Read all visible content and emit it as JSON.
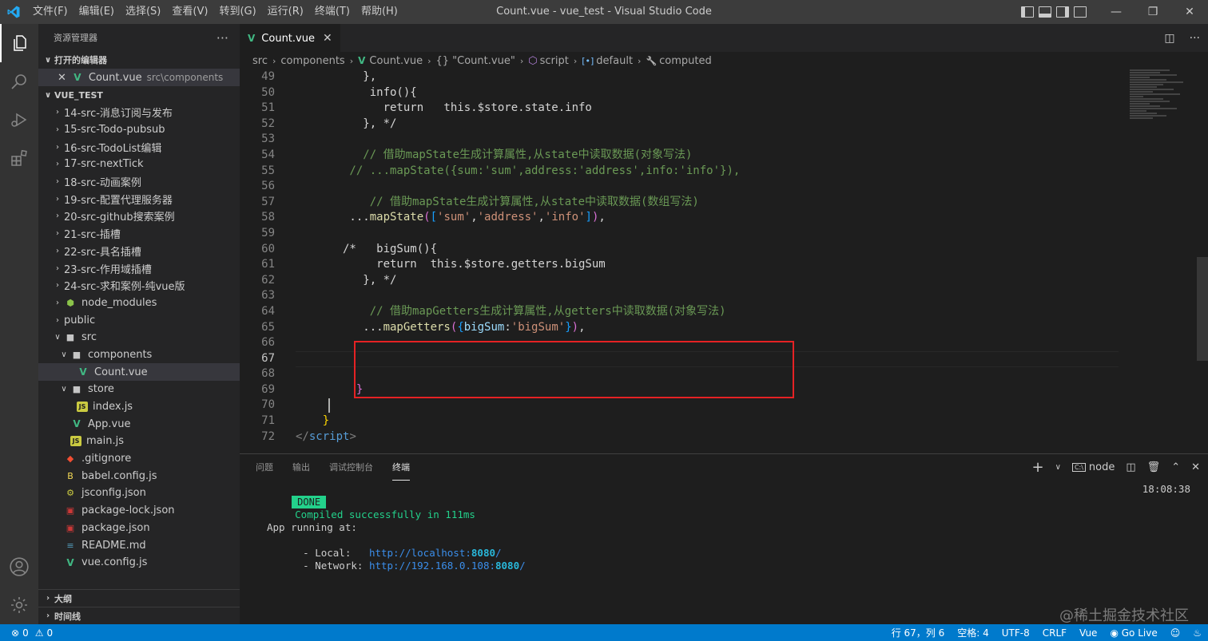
{
  "titlebar": {
    "title": "Count.vue - vue_test - Visual Studio Code",
    "menu": [
      "文件(F)",
      "编辑(E)",
      "选择(S)",
      "查看(V)",
      "转到(G)",
      "运行(R)",
      "终端(T)",
      "帮助(H)"
    ]
  },
  "sidebar": {
    "header": "资源管理器",
    "open_editors_label": "打开的编辑器",
    "open_editor": {
      "name": "Count.vue",
      "path": "src\\components"
    },
    "project_label": "VUE_TEST",
    "tree": [
      {
        "label": "14-src-消息订阅与发布",
        "type": "folder",
        "depth": 0
      },
      {
        "label": "15-src-Todo-pubsub",
        "type": "folder",
        "depth": 0
      },
      {
        "label": "16-src-TodoList编辑",
        "type": "folder",
        "depth": 0
      },
      {
        "label": "17-src-nextTick",
        "type": "folder",
        "depth": 0
      },
      {
        "label": "18-src-动画案例",
        "type": "folder",
        "depth": 0
      },
      {
        "label": "19-src-配置代理服务器",
        "type": "folder",
        "depth": 0
      },
      {
        "label": "20-src-github搜索案例",
        "type": "folder",
        "depth": 0
      },
      {
        "label": "21-src-插槽",
        "type": "folder",
        "depth": 0
      },
      {
        "label": "22-src-具名插槽",
        "type": "folder",
        "depth": 0
      },
      {
        "label": "23-src-作用域插槽",
        "type": "folder",
        "depth": 0
      },
      {
        "label": "24-src-求和案例-纯vue版",
        "type": "folder",
        "depth": 0
      },
      {
        "label": "node_modules",
        "type": "folder-node",
        "depth": 0
      },
      {
        "label": "public",
        "type": "folder",
        "depth": 0
      },
      {
        "label": "src",
        "type": "folder-open",
        "depth": 0
      },
      {
        "label": "components",
        "type": "folder-open",
        "depth": 1
      },
      {
        "label": "Count.vue",
        "type": "vue",
        "depth": 2,
        "selected": true
      },
      {
        "label": "store",
        "type": "folder-open",
        "depth": 1
      },
      {
        "label": "index.js",
        "type": "js",
        "depth": 2
      },
      {
        "label": "App.vue",
        "type": "vue",
        "depth": 1
      },
      {
        "label": "main.js",
        "type": "js",
        "depth": 1
      },
      {
        "label": ".gitignore",
        "type": "git",
        "depth": 0
      },
      {
        "label": "babel.config.js",
        "type": "babel",
        "depth": 0
      },
      {
        "label": "jsconfig.json",
        "type": "jsconfig",
        "depth": 0
      },
      {
        "label": "package-lock.json",
        "type": "npm",
        "depth": 0
      },
      {
        "label": "package.json",
        "type": "npm",
        "depth": 0
      },
      {
        "label": "README.md",
        "type": "md",
        "depth": 0
      },
      {
        "label": "vue.config.js",
        "type": "vue",
        "depth": 0
      }
    ],
    "outline_label": "大纲",
    "timeline_label": "时间线"
  },
  "editor": {
    "tab_label": "Count.vue",
    "breadcrumb": [
      "src",
      "components",
      "Count.vue",
      "{} \"Count.vue\"",
      "script",
      "default",
      "computed"
    ],
    "current_line": 67
  },
  "panel": {
    "tabs": [
      "问题",
      "输出",
      "调试控制台",
      "终端"
    ],
    "active_tab": "终端",
    "terminal_name": "node",
    "done_badge": "DONE",
    "compiled_msg": "Compiled successfully in 111ms",
    "time": "18:08:38",
    "app_running": "App running at:",
    "local_label": "- Local:   ",
    "local_url_prefix": "http://localhost:",
    "local_port": "8080",
    "local_url_suffix": "/",
    "network_label": "- Network: ",
    "network_url_prefix": "http://192.168.0.108:",
    "network_port": "8080",
    "network_url_suffix": "/"
  },
  "statusbar": {
    "errors": "0",
    "warnings": "0",
    "position": "行 67，列 6",
    "spaces": "空格: 4",
    "encoding": "UTF-8",
    "eol": "CRLF",
    "language": "Vue",
    "golive": "Go Live"
  },
  "watermark": "@稀土掘金技术社区",
  "colors": {
    "statusbar": "#007acc",
    "highlight_box": "#e52224",
    "done_badge": "#23d18b"
  }
}
